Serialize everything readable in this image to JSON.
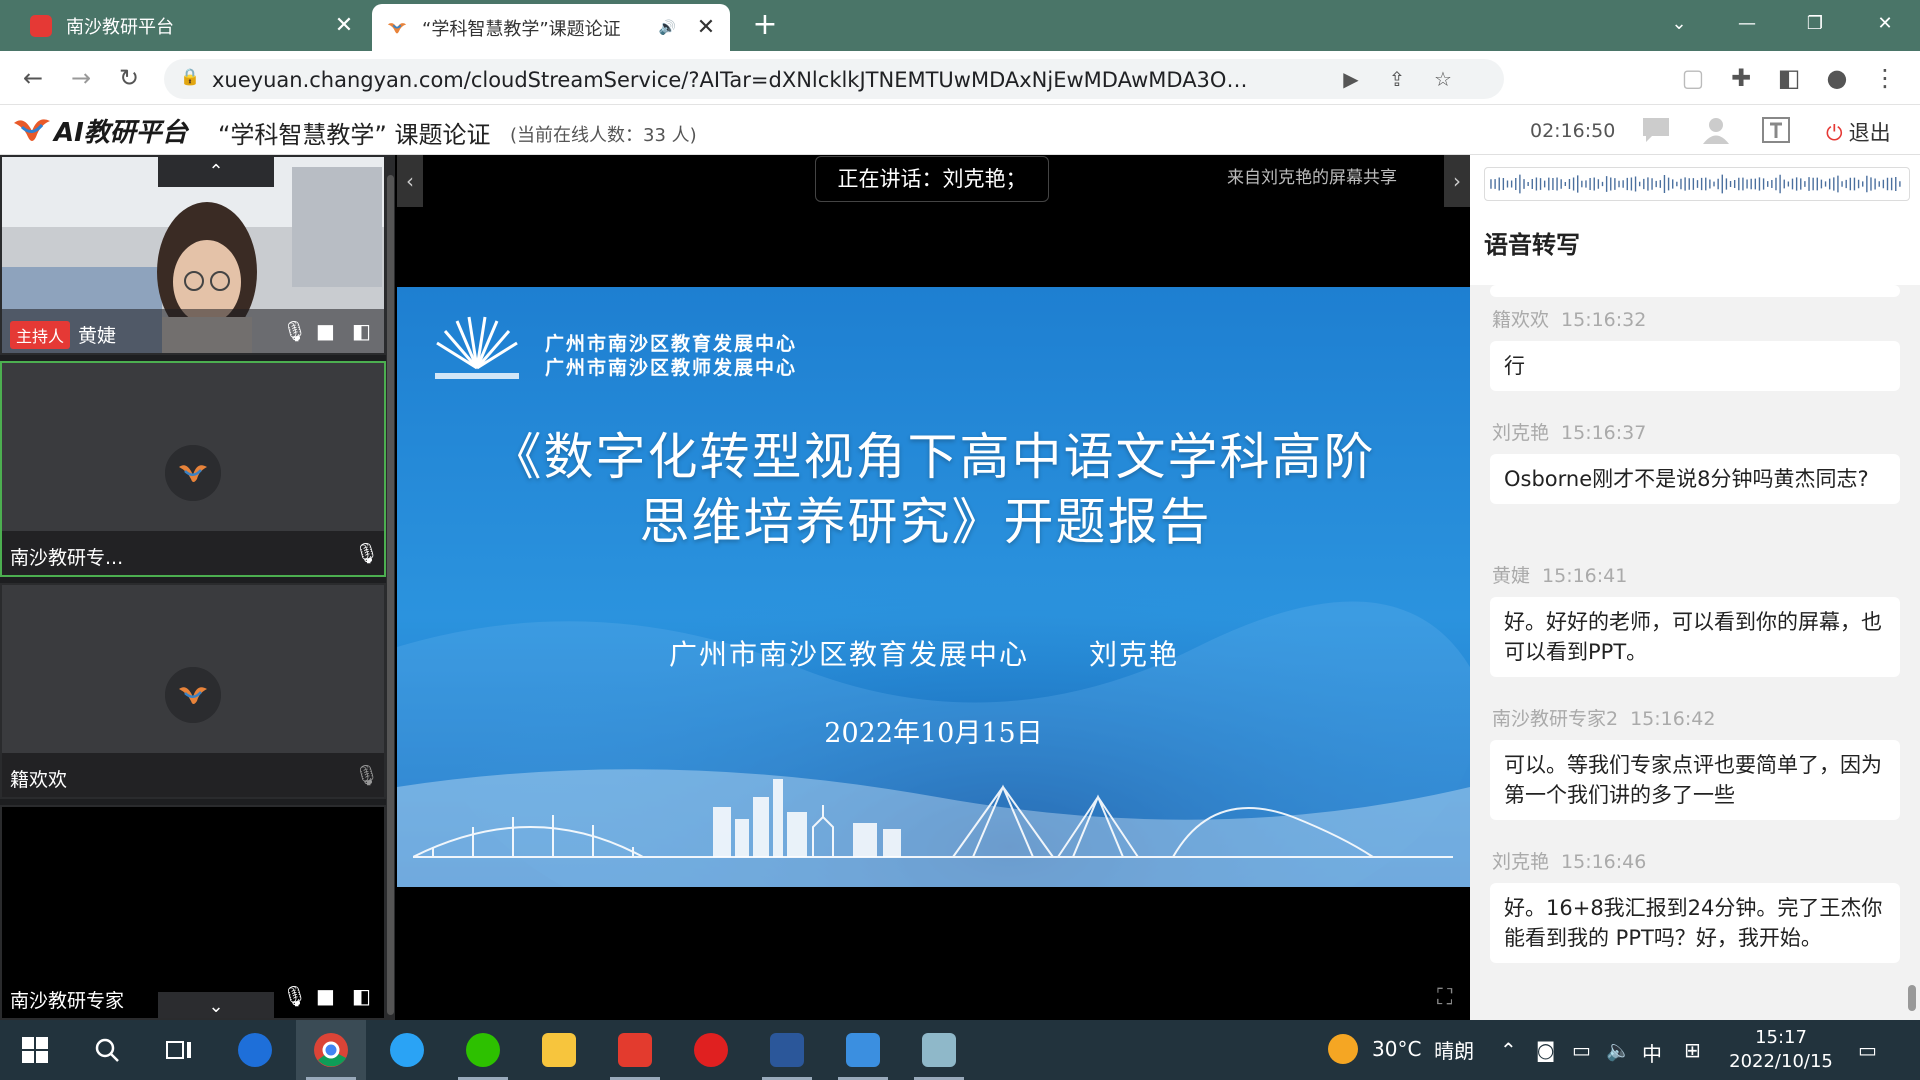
{
  "browser": {
    "tabs": [
      {
        "title": "南沙教研平台",
        "favicon_color": "#e53935"
      },
      {
        "title": "“学科智慧教学”课题论证",
        "favicon_color": "#e8833a"
      }
    ],
    "new_tab_glyph": "+",
    "url": "xueyuan.changyan.com/cloudStreamService/?AITar=dXNlcklkJTNEMTUwMDAxNjEwMDAwMDA3ODk5NiUyNnVzZXJOYW1lJTN..."
  },
  "app": {
    "logo_text": "AI教研平台",
    "meeting_title": "“学科智慧教学” 课题论证",
    "online_count": "(当前在线人数：33 人)",
    "clock": "02:16:50",
    "exit_label": "退出"
  },
  "participants": [
    {
      "name": "黄婕",
      "badge": "主持人",
      "mic": "on"
    },
    {
      "name": "南沙教研专...",
      "mic": "on"
    },
    {
      "name": "籍欢欢",
      "mic": "muted"
    },
    {
      "name": "南沙教研专家",
      "mic": "on"
    }
  ],
  "stage": {
    "speaking_label": "正在讲话：刘克艳；",
    "share_source": "来自刘克艳的屏幕共享",
    "slide": {
      "org_line1": "广州市南沙区教育发展中心",
      "org_line2": "广州市南沙区教师发展中心",
      "title_line1": "《数字化转型视角下高中语文学科高阶",
      "title_line2": "思维培养研究》开题报告",
      "presenter_org": "广州市南沙区教育发展中心",
      "presenter_name": "刘克艳",
      "date": "2022年10月15日"
    }
  },
  "transcript": {
    "title": "语音转写",
    "messages": [
      {
        "speaker": "籍欢欢",
        "time": "15:16:32",
        "text": "行"
      },
      {
        "speaker": "刘克艳",
        "time": "15:16:37",
        "text": "Osborne刚才不是说8分钟吗黄杰同志?"
      },
      {
        "speaker": "黄婕",
        "time": "15:16:41",
        "text": "好。好好的老师，可以看到你的屏幕，也可以看到PPT。"
      },
      {
        "speaker": "南沙教研专家2",
        "time": "15:16:42",
        "text": "可以。等我们专家点评也要简单了，因为第一个我们讲的多了一些"
      },
      {
        "speaker": "刘克艳",
        "time": "15:16:46",
        "text": "好。16+8我汇报到24分钟。完了王杰你能看到我的 PPT吗？好，我开始。"
      }
    ]
  },
  "taskbar": {
    "weather_temp": "30°C",
    "weather_desc": "晴朗",
    "ime_label": "中",
    "time": "15:17",
    "date": "2022/10/15"
  }
}
